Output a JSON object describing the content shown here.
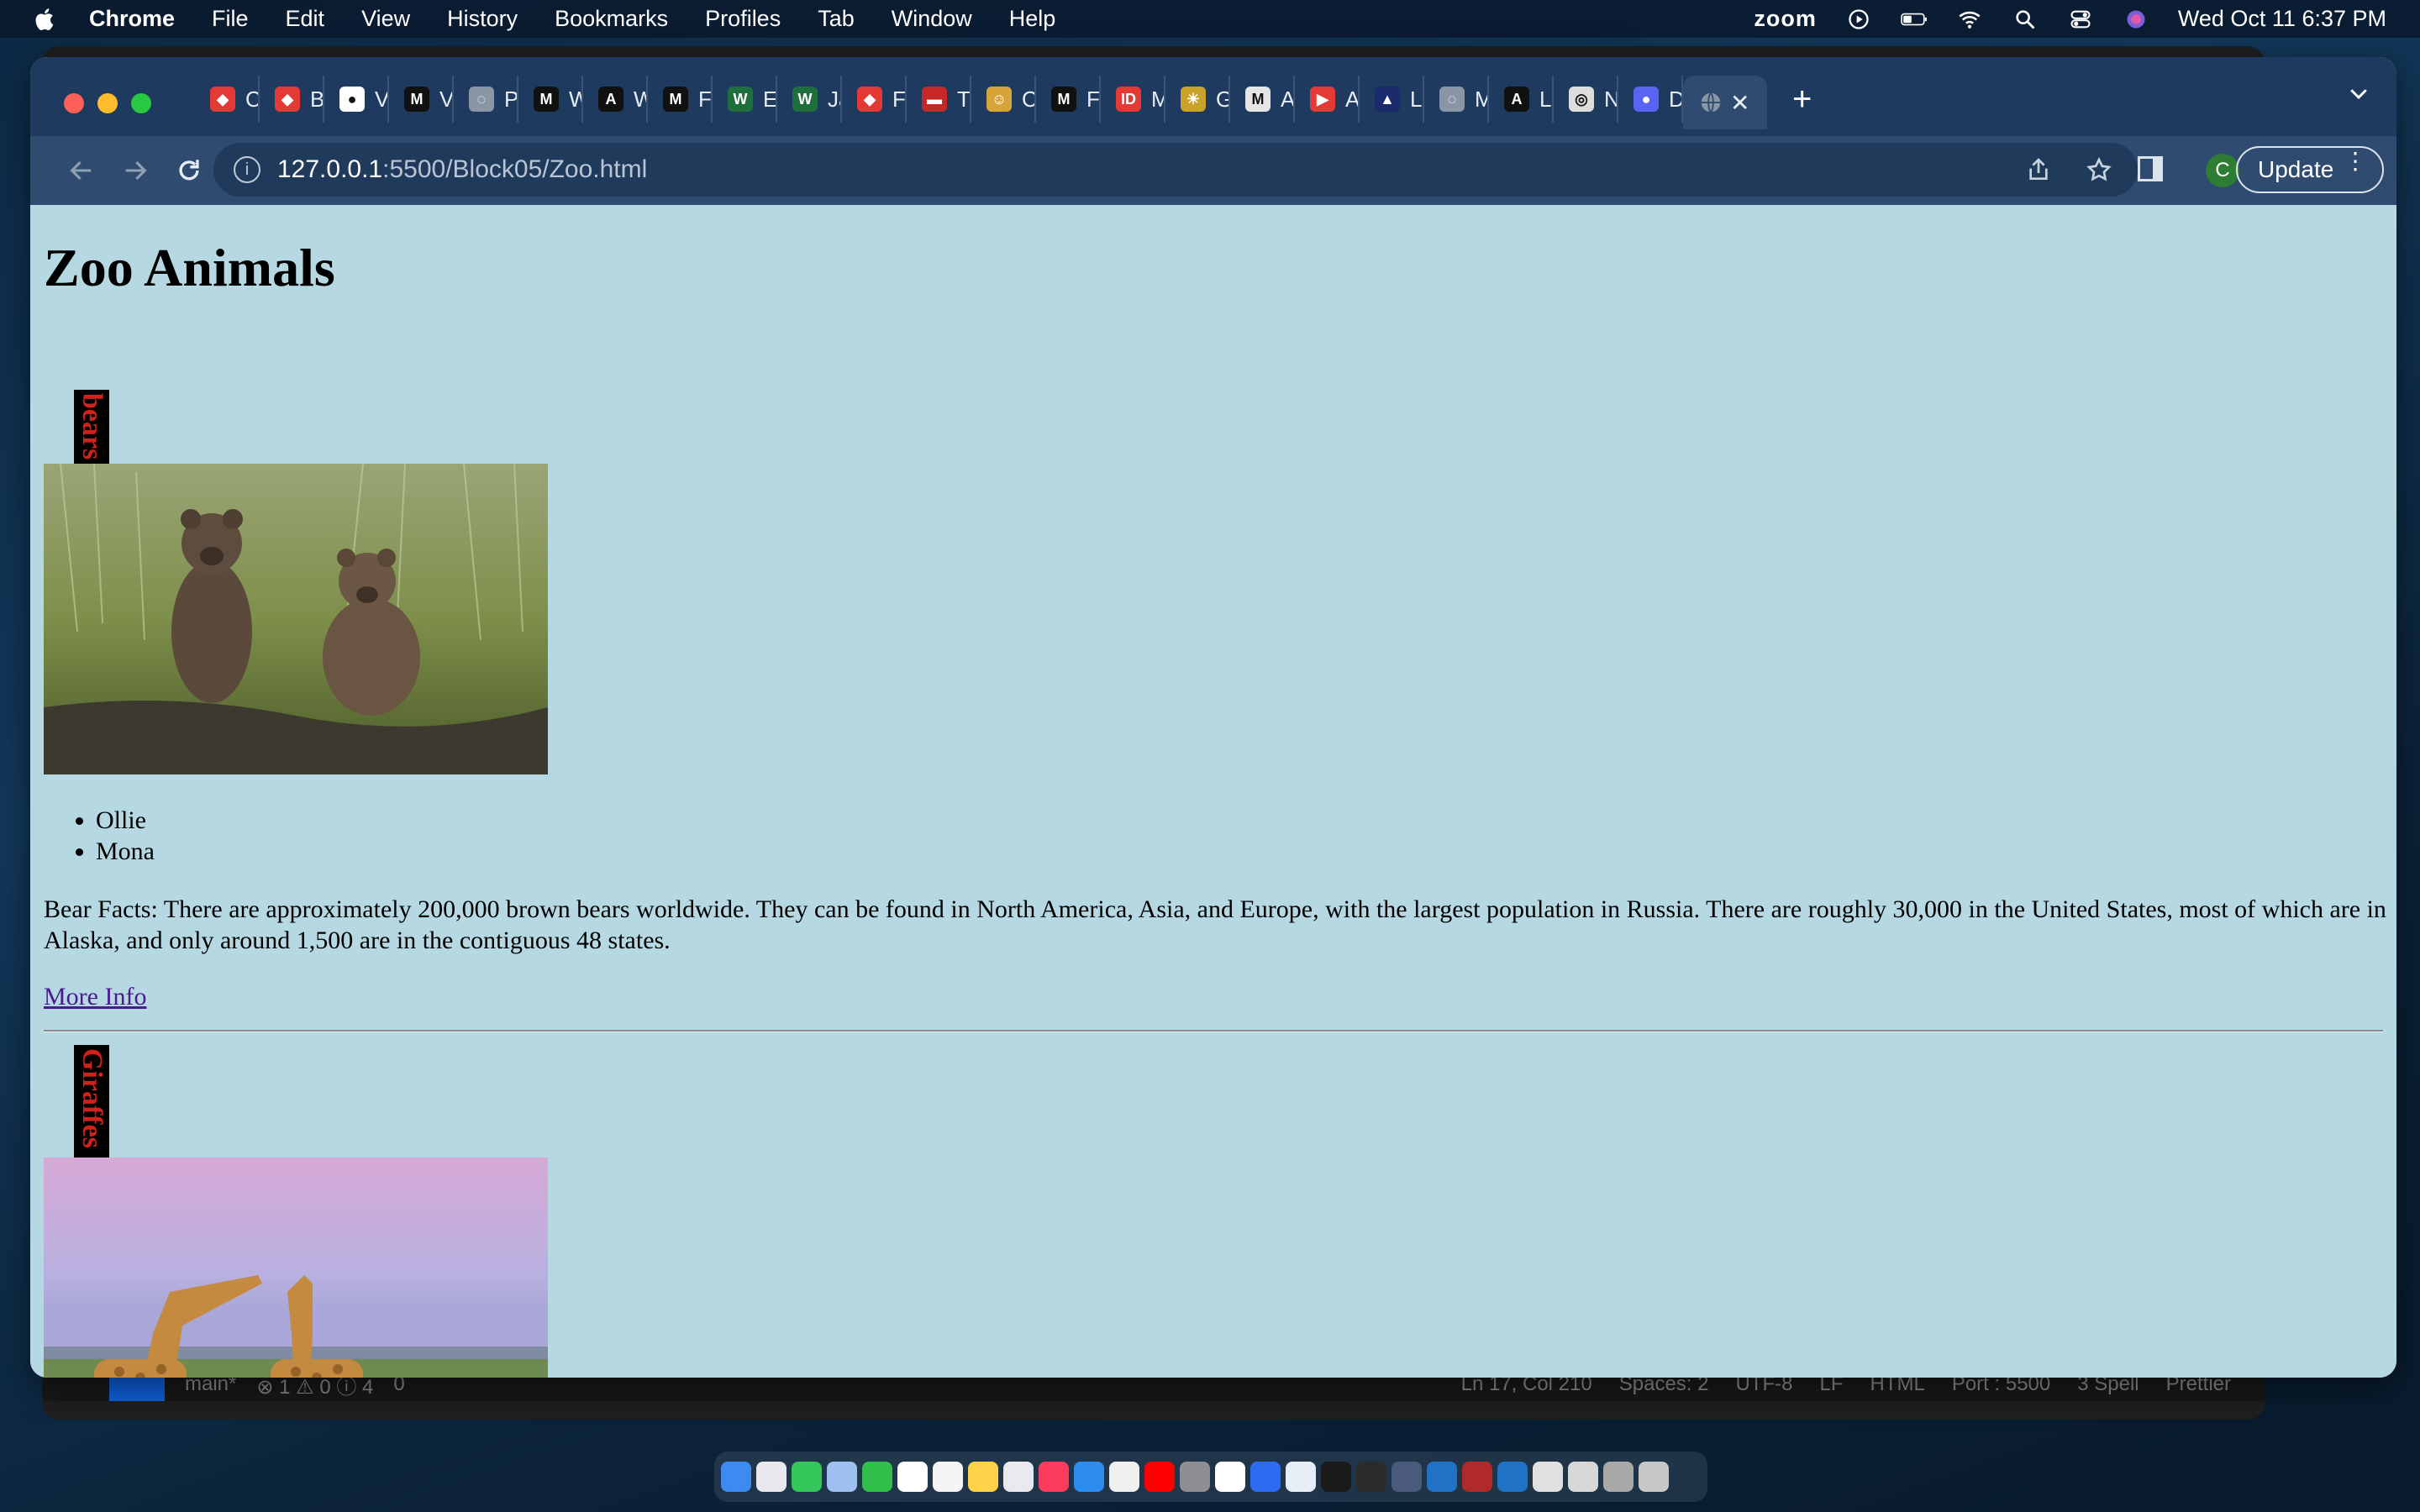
{
  "menubar": {
    "app": "Chrome",
    "items": [
      "File",
      "Edit",
      "View",
      "History",
      "Bookmarks",
      "Profiles",
      "Tab",
      "Window",
      "Help"
    ],
    "zoom_label": "zoom",
    "datetime": "Wed Oct 11  6:37 PM"
  },
  "vscode_status": {
    "branch": "main*",
    "problems": "⊗ 1 ⚠ 0 ⓘ 4",
    "ports": "0",
    "position": "Ln 17, Col 210",
    "spaces": "Spaces: 2",
    "encoding": "UTF-8",
    "eol": "LF",
    "language": "HTML",
    "port": "Port : 5500",
    "spell": "3 Spell",
    "prettier": "Prettier"
  },
  "tabs": [
    {
      "label": "C",
      "color": "#e53935",
      "glyph": "◆"
    },
    {
      "label": "Bl",
      "color": "#e53935",
      "glyph": "◆"
    },
    {
      "label": "Vi",
      "color": "#ffffff",
      "glyph": "●"
    },
    {
      "label": "Va",
      "color": "#111111",
      "glyph": "M"
    },
    {
      "label": "Pe",
      "color": "#8a96a6",
      "glyph": "◌"
    },
    {
      "label": "W",
      "color": "#111111",
      "glyph": "M"
    },
    {
      "label": "W",
      "color": "#111111",
      "glyph": "A"
    },
    {
      "label": "Fu",
      "color": "#111111",
      "glyph": "M"
    },
    {
      "label": "Ex",
      "color": "#1e6f3c",
      "glyph": "W"
    },
    {
      "label": "Ja",
      "color": "#1e6f3c",
      "glyph": "W"
    },
    {
      "label": "Fu",
      "color": "#e53935",
      "glyph": "◆"
    },
    {
      "label": "Tl",
      "color": "#c62828",
      "glyph": "▬"
    },
    {
      "label": "C",
      "color": "#d8a43a",
      "glyph": "☺"
    },
    {
      "label": "Fl",
      "color": "#111111",
      "glyph": "M"
    },
    {
      "label": "M",
      "color": "#e53935",
      "glyph": "ID"
    },
    {
      "label": "G",
      "color": "#c9a227",
      "glyph": "☀"
    },
    {
      "label": "A",
      "color": "#e6e6e6",
      "glyph": "M"
    },
    {
      "label": "A",
      "color": "#e53935",
      "glyph": "▶"
    },
    {
      "label": "Lo",
      "color": "#1a2a6c",
      "glyph": "▲"
    },
    {
      "label": "M",
      "color": "#8a96a6",
      "glyph": "◌"
    },
    {
      "label": "Le",
      "color": "#111111",
      "glyph": "A"
    },
    {
      "label": "N",
      "color": "#dddddd",
      "glyph": "◎"
    },
    {
      "label": "D",
      "color": "#5865f2",
      "glyph": "●"
    }
  ],
  "active_tab": {
    "icon": "globe-icon",
    "close": "✕"
  },
  "new_tab": "+",
  "address": {
    "host": "127.0.0.1",
    "path": ":5500/Block05/Zoo.html"
  },
  "profile_initial": "C",
  "update_label": "Update",
  "page": {
    "title": "Zoo Animals",
    "sections": [
      {
        "label": "bears",
        "names": [
          "Ollie",
          "Mona"
        ],
        "facts": "Bear Facts: There are approximately 200,000 brown bears worldwide. They can be found in North America, Asia, and Europe, with the largest population in Russia. There are roughly 30,000 in the United States, most of which are in Alaska, and only around 1,500 are in the contiguous 48 states.",
        "link": "More Info"
      },
      {
        "label": "Giraffes"
      }
    ]
  }
}
